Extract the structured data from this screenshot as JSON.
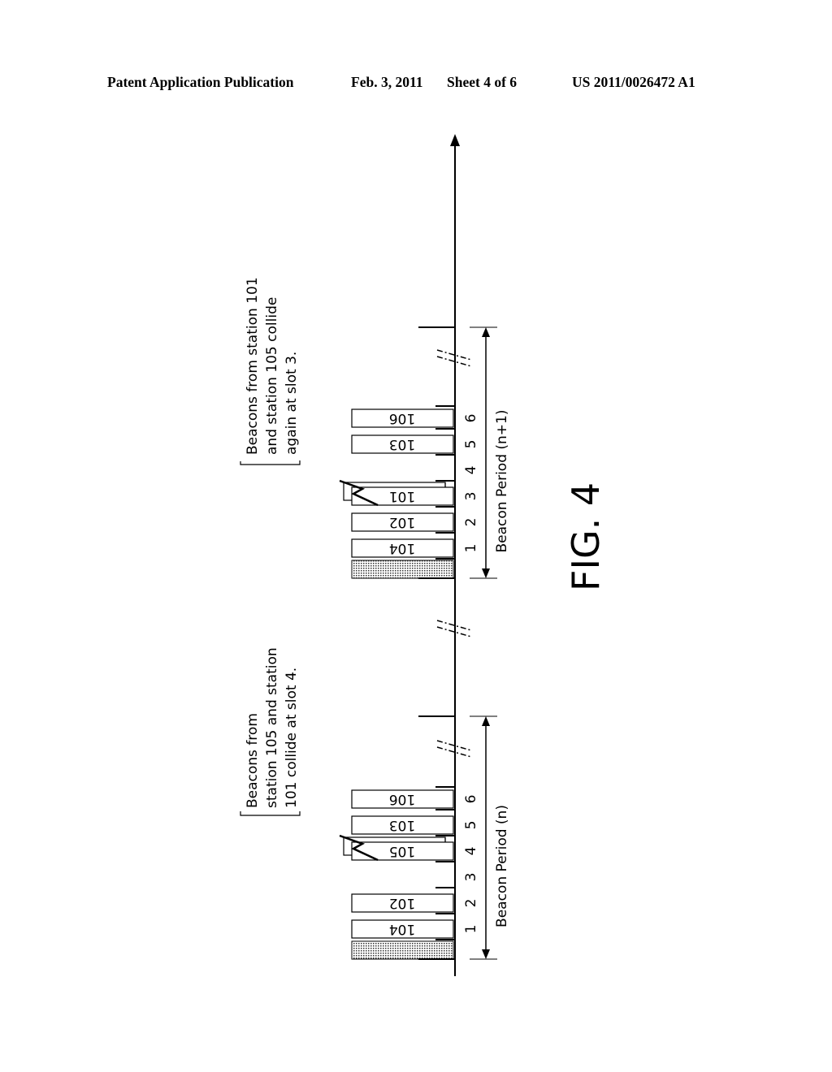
{
  "header": {
    "publication": "Patent Application Publication",
    "date": "Feb. 3, 2011",
    "sheet": "Sheet 4 of 6",
    "number": "US 2011/0026472 A1"
  },
  "figure": {
    "label": "FIG. 4",
    "periods": [
      {
        "name": "Beacon Period (n+1)",
        "annotation": [
          "Beacons from station 101",
          "and station 105 collide",
          "again at slot 3."
        ],
        "slots": [
          {
            "slot": "1",
            "station": "104"
          },
          {
            "slot": "2",
            "station": "102"
          },
          {
            "slot": "3",
            "station": "101",
            "collision": true
          },
          {
            "slot": "4",
            "station": ""
          },
          {
            "slot": "5",
            "station": "103"
          },
          {
            "slot": "6",
            "station": "106"
          }
        ]
      },
      {
        "name": "Beacon Period (n)",
        "annotation": [
          "Beacons from",
          "station 105 and station",
          "101 collide at slot 4."
        ],
        "slots": [
          {
            "slot": "1",
            "station": "104"
          },
          {
            "slot": "2",
            "station": "102"
          },
          {
            "slot": "3",
            "station": ""
          },
          {
            "slot": "4",
            "station": "105",
            "collision": true
          },
          {
            "slot": "5",
            "station": "103"
          },
          {
            "slot": "6",
            "station": "106"
          }
        ]
      }
    ]
  }
}
